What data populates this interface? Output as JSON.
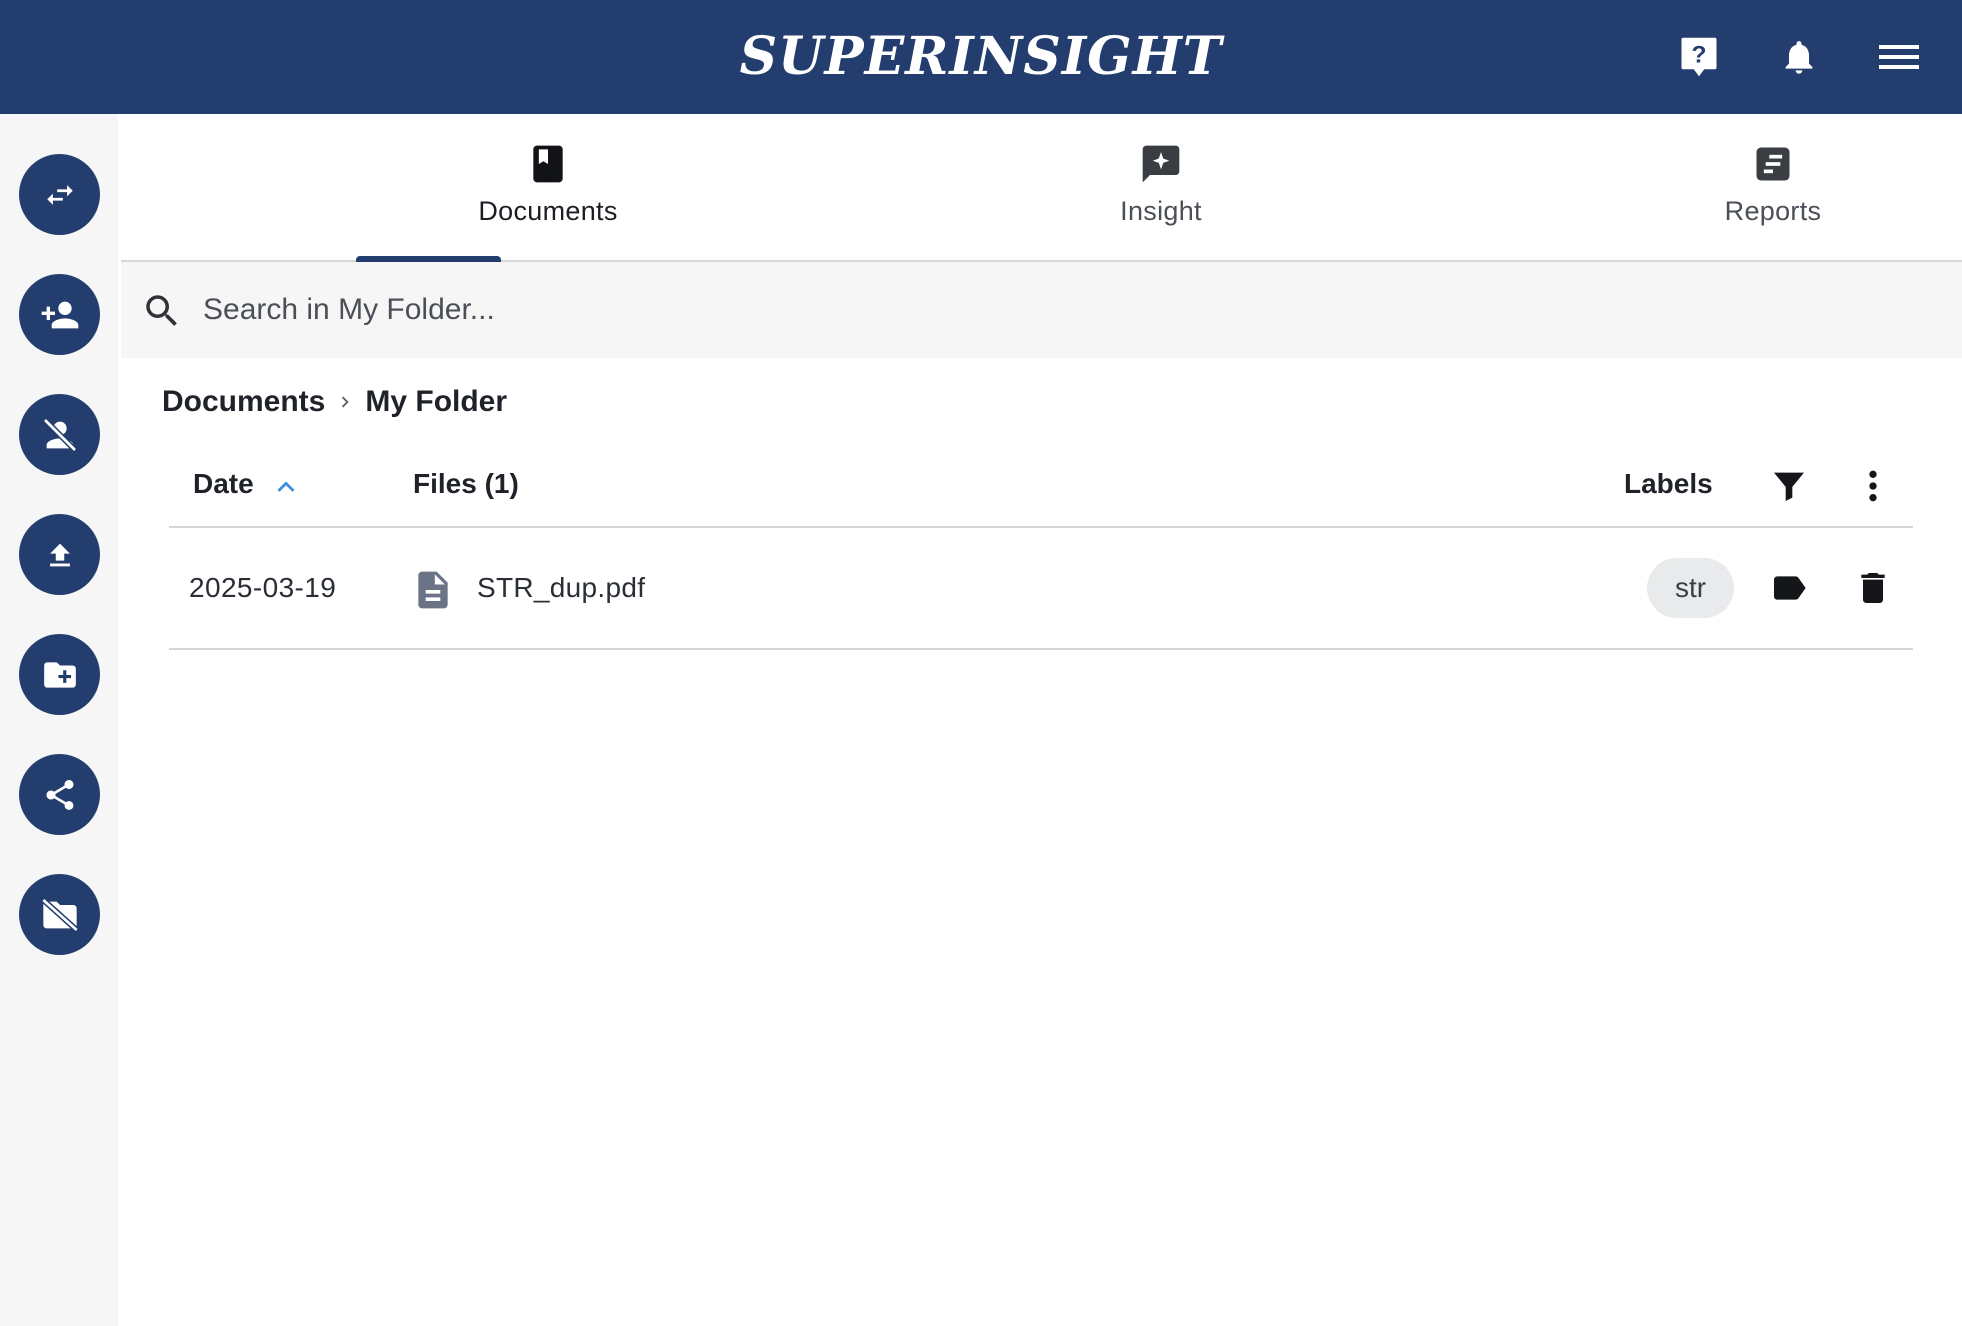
{
  "header": {
    "brand": "SUPERINSIGHT",
    "icons": [
      "help-icon",
      "notifications-bell-icon",
      "hamburger-menu-icon"
    ]
  },
  "sidebar": {
    "items": [
      {
        "icon": "swap-arrows-icon"
      },
      {
        "icon": "add-person-icon"
      },
      {
        "icon": "remove-person-icon"
      },
      {
        "icon": "upload-icon"
      },
      {
        "icon": "new-folder-icon"
      },
      {
        "icon": "share-icon"
      },
      {
        "icon": "folder-off-icon"
      }
    ]
  },
  "tabs": [
    {
      "label": "Documents",
      "icon": "book-icon",
      "active": true
    },
    {
      "label": "Insight",
      "icon": "sparkle-chat-icon",
      "active": false
    },
    {
      "label": "Reports",
      "icon": "report-icon",
      "active": false
    }
  ],
  "search": {
    "placeholder": "Search in My Folder...",
    "value": ""
  },
  "breadcrumb": {
    "root": "Documents",
    "current": "My Folder"
  },
  "table": {
    "headers": {
      "date": "Date",
      "files": "Files (1)",
      "labels": "Labels"
    },
    "sort": {
      "column": "date",
      "direction": "ascending"
    },
    "rows": [
      {
        "date": "2025-03-19",
        "file": "STR_dup.pdf",
        "label": "str"
      }
    ]
  },
  "colors": {
    "primary": "#233e6e",
    "accent": "#3d8fe0",
    "chip_bg": "#e9eaec",
    "rail_bg": "#f6f6f7"
  }
}
